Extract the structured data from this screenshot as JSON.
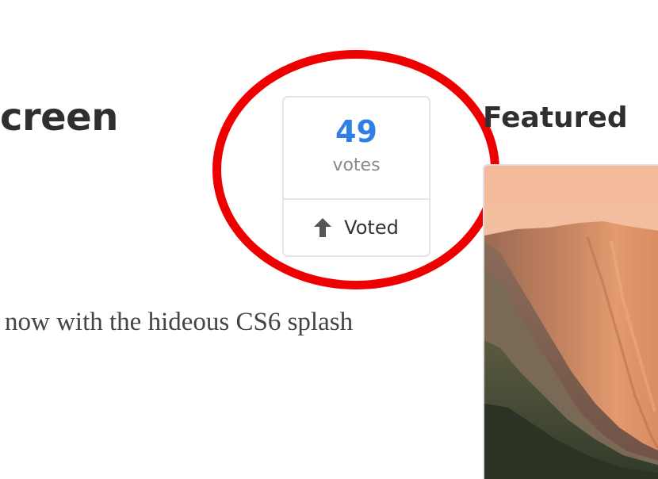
{
  "post": {
    "title_fragment": "creen",
    "body_fragment": "now with the hideous CS6 splash"
  },
  "vote": {
    "count": "49",
    "count_label": "votes",
    "button_label": "Voted",
    "button_icon": "arrow-up-icon",
    "count_color": "#2f7fe6"
  },
  "highlight": {
    "color": "#ee0000"
  },
  "sidebar": {
    "featured_heading": "Featured",
    "featured_image_subject": "mountain-cliff-sunset"
  }
}
